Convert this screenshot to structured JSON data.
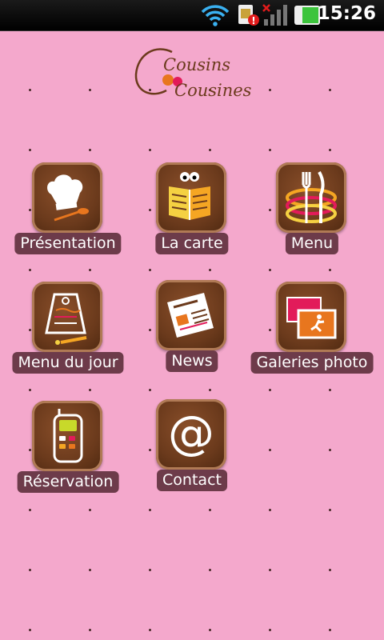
{
  "status_bar": {
    "time": "15:26",
    "icons": [
      "wifi-icon",
      "sim-alert-icon",
      "signal-icon",
      "battery-icon"
    ]
  },
  "app": {
    "logo_text_top": "Cousins",
    "logo_text_bottom": "Cousines"
  },
  "colors": {
    "background": "#f4a8cc",
    "tile_brown": "#6b3a1c",
    "label_bg": "#6d3b4a",
    "accent_orange": "#e8761e"
  },
  "menu": [
    {
      "label": "Présentation",
      "icon": "chef-hat-icon"
    },
    {
      "label": "La carte",
      "icon": "open-menu-book-icon"
    },
    {
      "label": "Menu",
      "icon": "fork-knife-plate-icon"
    },
    {
      "label": "Menu du jour",
      "icon": "daily-board-icon"
    },
    {
      "label": "News",
      "icon": "newspaper-icon"
    },
    {
      "label": "Galeries photo",
      "icon": "photo-gallery-icon"
    },
    {
      "label": "Réservation",
      "icon": "phone-icon"
    },
    {
      "label": "Contact",
      "icon": "at-sign-icon"
    }
  ]
}
